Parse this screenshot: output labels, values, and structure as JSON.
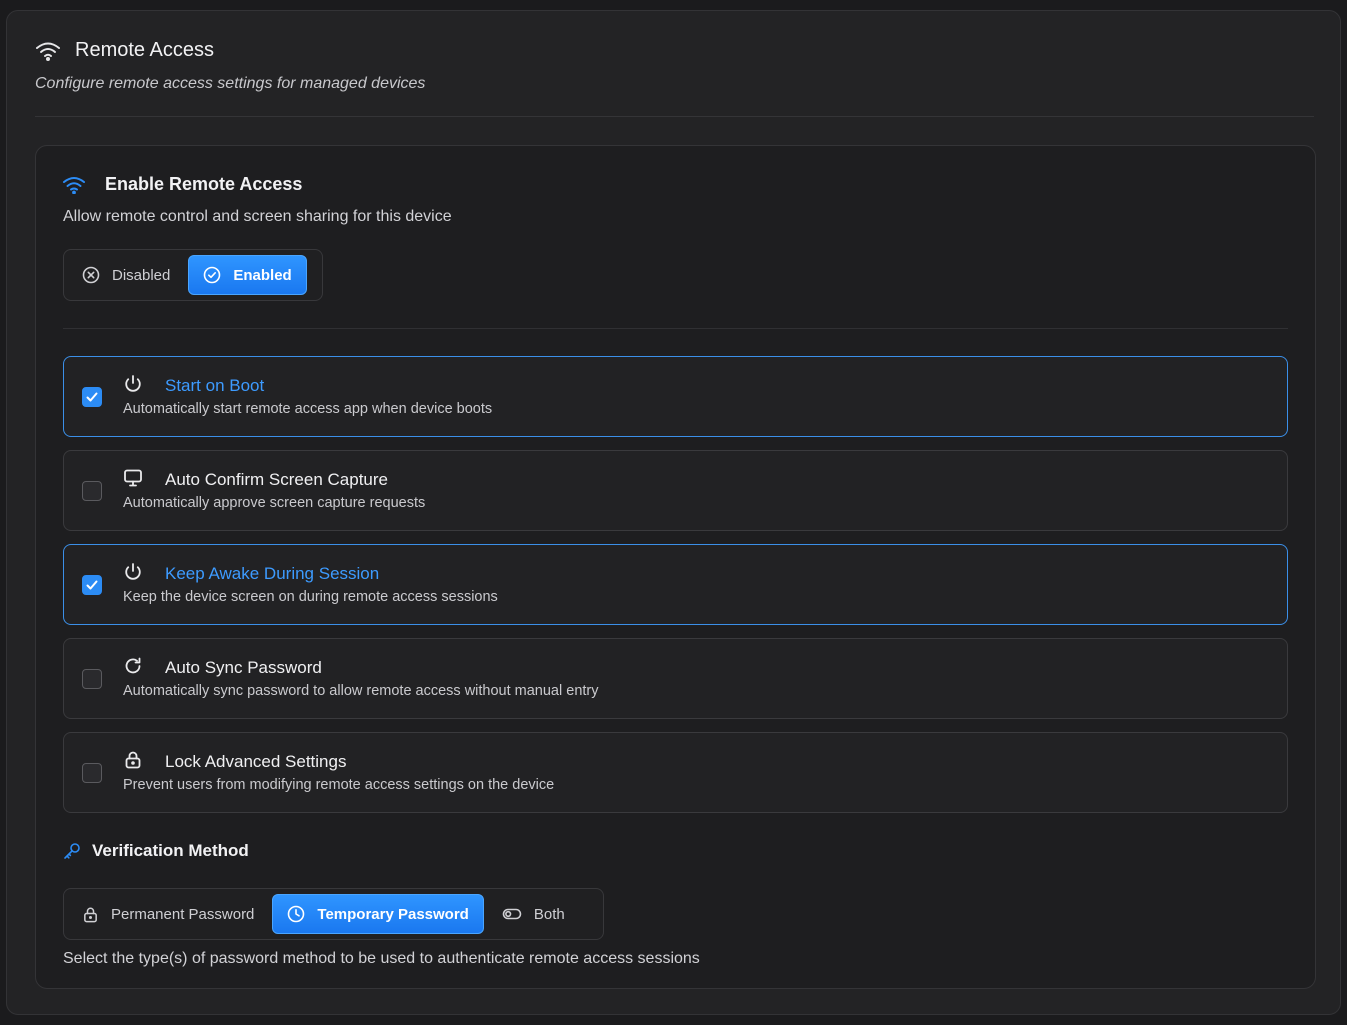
{
  "header": {
    "title": "Remote Access",
    "subtitle": "Configure remote access settings for managed devices",
    "icon": "wifi-icon"
  },
  "enable_section": {
    "title": "Enable Remote Access",
    "description": "Allow remote control and screen sharing for this device",
    "icon": "wifi-icon",
    "toggle": {
      "options": [
        {
          "label": "Disabled",
          "icon": "x-circle-icon"
        },
        {
          "label": "Enabled",
          "icon": "check-circle-icon"
        }
      ],
      "selected": "Enabled"
    }
  },
  "options": [
    {
      "title": "Start on Boot",
      "description": "Automatically start remote access app when device boots",
      "icon": "power-icon",
      "checked": true
    },
    {
      "title": "Auto Confirm Screen Capture",
      "description": "Automatically approve screen capture requests",
      "icon": "monitor-icon",
      "checked": false
    },
    {
      "title": "Keep Awake During Session",
      "description": "Keep the device screen on during remote access sessions",
      "icon": "power-icon",
      "checked": true
    },
    {
      "title": "Auto Sync Password",
      "description": "Automatically sync password to allow remote access without manual entry",
      "icon": "refresh-icon",
      "checked": false
    },
    {
      "title": "Lock Advanced Settings",
      "description": "Prevent users from modifying remote access settings on the device",
      "icon": "lock-icon",
      "checked": false
    }
  ],
  "verification": {
    "title": "Verification Method",
    "icon": "key-icon",
    "options": [
      {
        "label": "Permanent Password",
        "icon": "lock-icon"
      },
      {
        "label": "Temporary Password",
        "icon": "clock-icon"
      },
      {
        "label": "Both",
        "icon": "toggle-icon"
      }
    ],
    "selected": "Temporary Password",
    "description": "Select the type(s) of password method to be used to authenticate remote access sessions"
  },
  "colors": {
    "accent": "#2c8cf5",
    "background": "#1b1b1d",
    "panel": "#232325"
  }
}
